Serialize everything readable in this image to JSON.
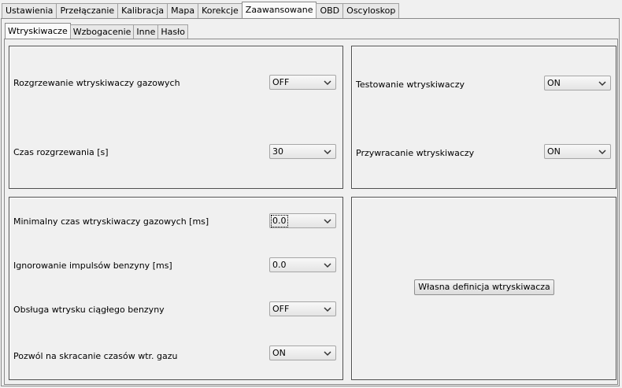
{
  "main_tabs": [
    "Ustawienia",
    "Przełączanie",
    "Kalibracja",
    "Mapa",
    "Korekcje",
    "Zaawansowane",
    "OBD",
    "Oscyloskop"
  ],
  "sub_tabs": [
    "Wtryskiwacze",
    "Wzbogacenie",
    "Inne",
    "Hasło"
  ],
  "top_left": {
    "warmup_label": "Rozgrzewanie wtryskiwaczy gazowych",
    "warmup_value": "OFF",
    "warmup_time_label": "Czas rozgrzewania [s]",
    "warmup_time_value": "30"
  },
  "top_right": {
    "test_label": "Testowanie wtryskiwaczy",
    "test_value": "ON",
    "restore_label": "Przywracanie wtryskiwaczy",
    "restore_value": "ON"
  },
  "bottom_left": {
    "min_time_label": "Minimalny czas wtryskiwaczy gazowych [ms]",
    "min_time_value": "0.0",
    "ignore_label": "Ignorowanie impulsów benzyny [ms]",
    "ignore_value": "0.0",
    "continuous_label": "Obsługa wtrysku ciągłego benzyny",
    "continuous_value": "OFF",
    "shorten_label": "Pozwól na skracanie czasów wtr. gazu",
    "shorten_value": "ON"
  },
  "bottom_right": {
    "custom_button": "Własna definicja wtryskiwacza"
  },
  "icons": {
    "dropdown": "chevron-down-icon"
  }
}
